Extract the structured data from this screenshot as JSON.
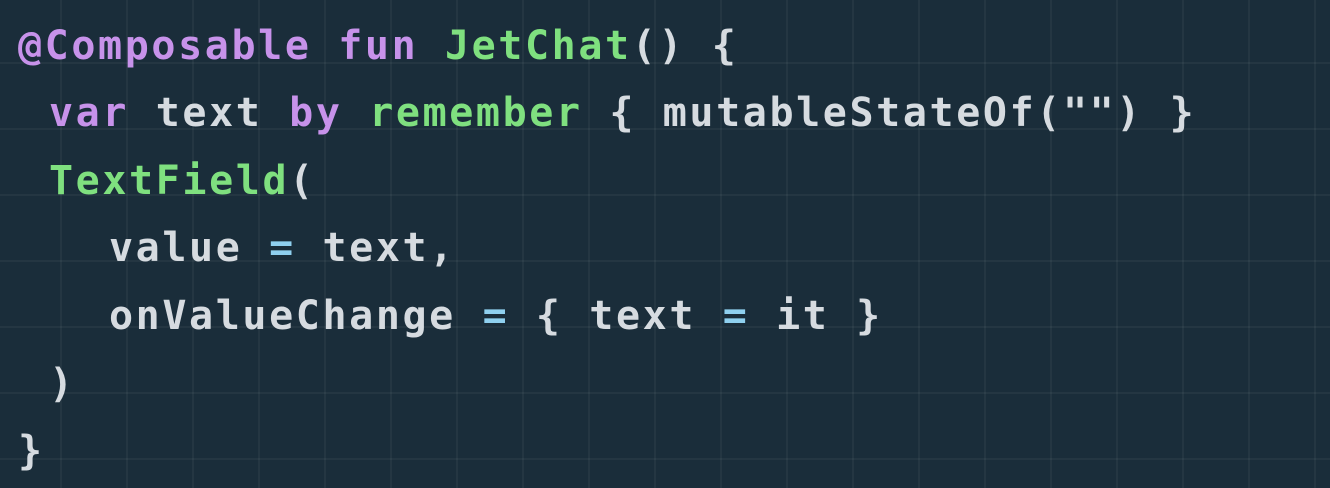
{
  "code_lines": [
    [
      {
        "text": "@Composable",
        "kind": "annotation"
      },
      {
        "text": " ",
        "kind": "plain"
      },
      {
        "text": "fun",
        "kind": "keyword"
      },
      {
        "text": " ",
        "kind": "plain"
      },
      {
        "text": "JetChat",
        "kind": "function"
      },
      {
        "text": "() {",
        "kind": "plain"
      }
    ],
    [
      {
        "text": "var",
        "kind": "keyword"
      },
      {
        "text": " text ",
        "kind": "plain"
      },
      {
        "text": "by",
        "kind": "keyword"
      },
      {
        "text": " ",
        "kind": "plain"
      },
      {
        "text": "remember",
        "kind": "function"
      },
      {
        "text": " { mutableStateOf(\"\") }",
        "kind": "plain"
      }
    ],
    [
      {
        "text": "TextField",
        "kind": "function"
      },
      {
        "text": "(",
        "kind": "plain"
      }
    ],
    [
      {
        "text": "value ",
        "kind": "plain"
      },
      {
        "text": "=",
        "kind": "operator"
      },
      {
        "text": " text,",
        "kind": "plain"
      }
    ],
    [
      {
        "text": "onValueChange ",
        "kind": "plain"
      },
      {
        "text": "=",
        "kind": "operator"
      },
      {
        "text": " { text ",
        "kind": "plain"
      },
      {
        "text": "=",
        "kind": "operator"
      },
      {
        "text": " it }",
        "kind": "plain"
      }
    ],
    [
      {
        "text": ")",
        "kind": "plain"
      }
    ],
    [
      {
        "text": "}",
        "kind": "plain"
      }
    ]
  ],
  "colors": {
    "background": "#1a2d3a",
    "annotation": "#c792ea",
    "keyword": "#c792ea",
    "function": "#7fe07f",
    "plain": "#d6dbe0",
    "operator": "#8fd0ef"
  }
}
